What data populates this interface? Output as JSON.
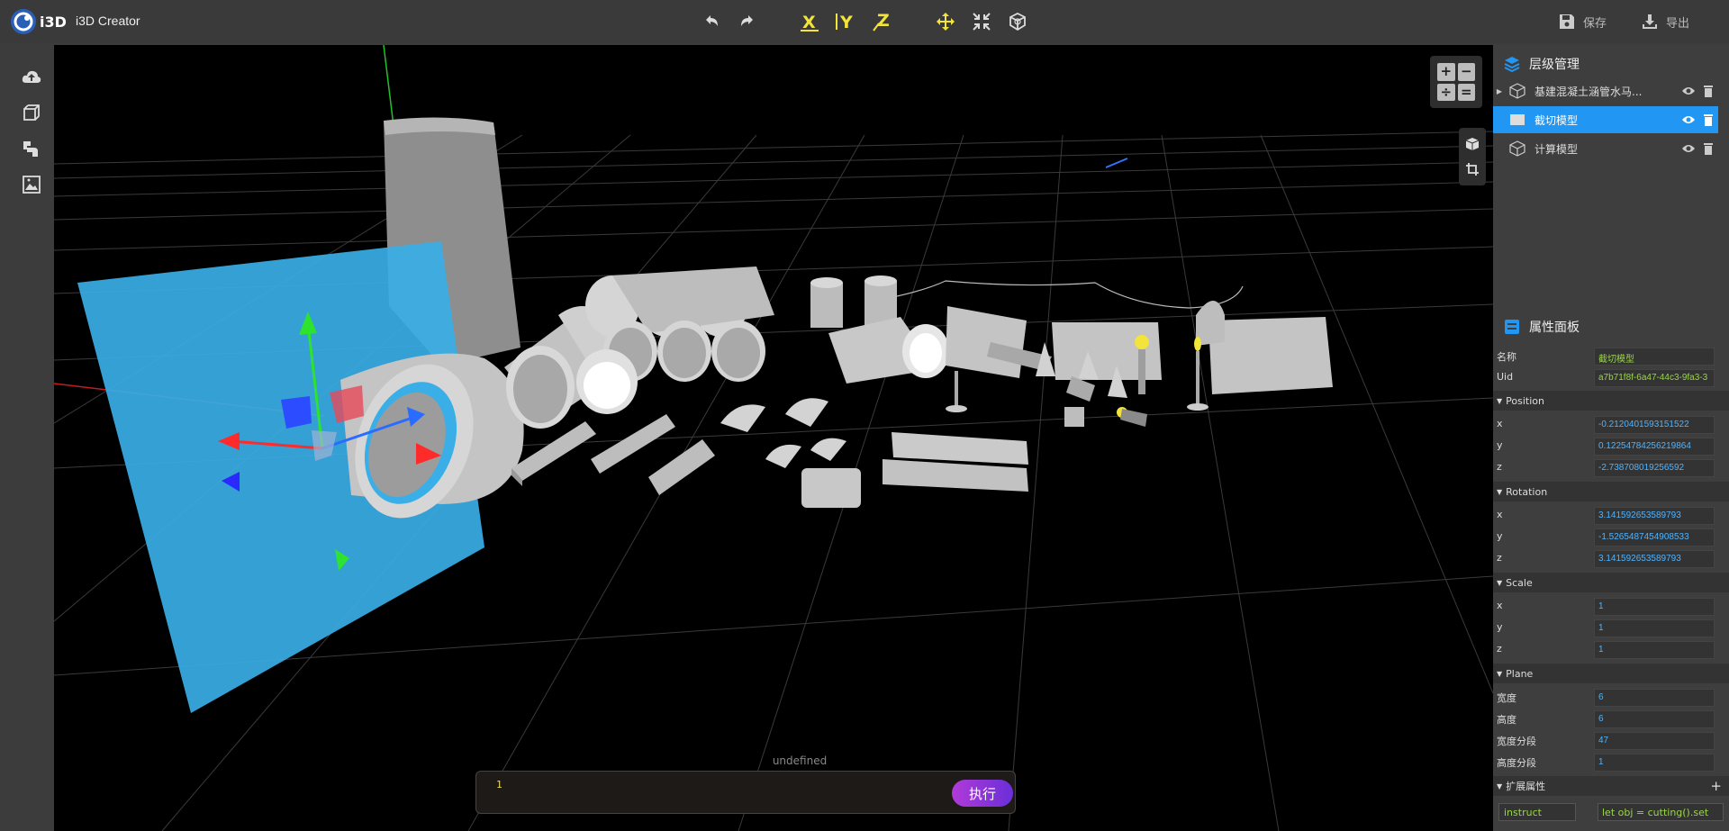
{
  "app": {
    "title": "i3D Creator",
    "logo_text": "i3D"
  },
  "toolbar": {
    "undo_icon": "undo-icon",
    "redo_icon": "redo-icon",
    "axis_x": "X",
    "axis_y": "Y",
    "axis_z": "Z",
    "save_label": "保存",
    "export_label": "导出"
  },
  "viewport": {
    "console_label": "undefined",
    "console_line_number": "1",
    "run_button": "执行",
    "zoom_buttons": [
      "+",
      "−",
      "÷",
      "="
    ]
  },
  "hierarchy": {
    "title": "层级管理",
    "items": [
      {
        "label": "基建混凝土涵管水马...",
        "selected": false,
        "expandable": true
      },
      {
        "label": "截切模型",
        "selected": true,
        "expandable": false
      },
      {
        "label": "计算模型",
        "selected": false,
        "expandable": false
      }
    ]
  },
  "properties": {
    "title": "属性面板",
    "name_label": "名称",
    "name_value": "截切模型",
    "uid_label": "Uid",
    "uid_value": "a7b71f8f-6a47-44c3-9fa3-3",
    "position": {
      "title": "Position",
      "x": "-0.2120401593151522",
      "y": "0.12254784256219864",
      "z": "-2.738708019256592"
    },
    "rotation": {
      "title": "Rotation",
      "x": "3.141592653589793",
      "y": "-1.5265487454908533",
      "z": "3.141592653589793"
    },
    "scale": {
      "title": "Scale",
      "x": "1",
      "y": "1",
      "z": "1"
    },
    "plane": {
      "title": "Plane",
      "width_label": "宽度",
      "width": "6",
      "height_label": "高度",
      "height": "6",
      "wseg_label": "宽度分段",
      "wseg": "47",
      "hseg_label": "高度分段",
      "hseg": "1"
    },
    "extended": {
      "title": "扩展属性",
      "add": "+",
      "key": "instruct",
      "value": "let obj = cutting().set"
    },
    "axis_labels": {
      "x": "x",
      "y": "y",
      "z": "z"
    }
  },
  "colors": {
    "accent": "#2196f3",
    "axis_yellow": "#f2e43a",
    "run_gradient_start": "#b13ad8",
    "run_gradient_end": "#6a2fd8",
    "value_blue": "#4fb3ff",
    "value_green": "#9ad44a"
  }
}
